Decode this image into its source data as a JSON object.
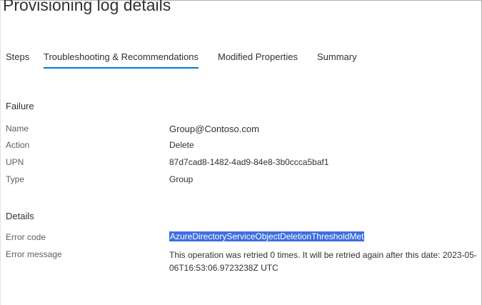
{
  "page": {
    "title": "Provisioning log details"
  },
  "tabs": [
    {
      "label": "Steps",
      "active": false
    },
    {
      "label": "Troubleshooting & Recommendations",
      "active": true
    },
    {
      "label": "Modified Properties",
      "active": false
    },
    {
      "label": "Summary",
      "active": false
    }
  ],
  "failure": {
    "heading": "Failure",
    "rows": [
      {
        "label": "Name",
        "value": "Group@Contoso.com"
      },
      {
        "label": "Action",
        "value": "Delete"
      },
      {
        "label": "UPN",
        "value": "87d7cad8-1482-4ad9-84e8-3b0ccca5baf1"
      },
      {
        "label": "Type",
        "value": "Group"
      }
    ]
  },
  "details": {
    "heading": "Details",
    "error_code_label": "Error code",
    "error_code": "AzureDirectoryServiceObjectDeletionThresholdMet",
    "error_message_label": "Error message",
    "error_message": "This operation was retried 0 times. It will be retried again after this date: 2023-05-06T16:53:06.9723238Z UTC"
  },
  "colors": {
    "accent": "#0078d4",
    "selection": "#3d6fe0"
  }
}
